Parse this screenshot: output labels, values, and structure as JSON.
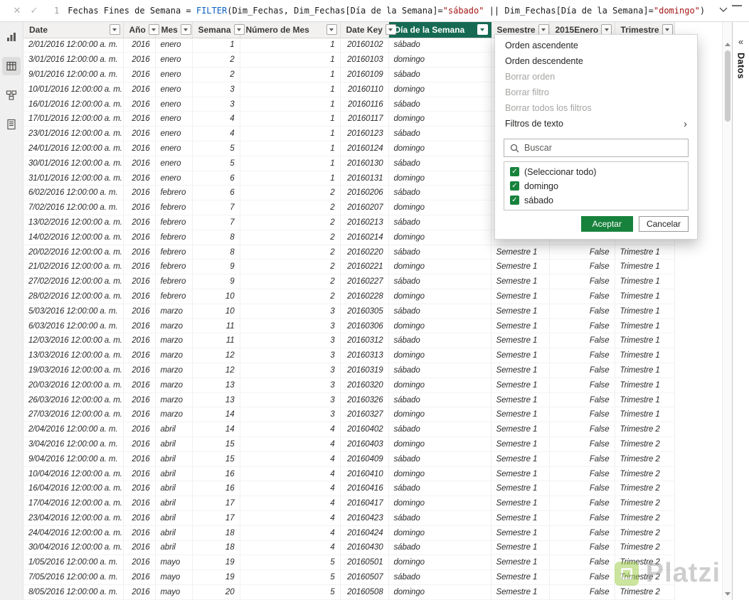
{
  "formula_bar": {
    "line_number": "1",
    "tokens": [
      {
        "text": "Fechas Fines de Semana = ",
        "type": "plain"
      },
      {
        "text": "FILTER",
        "type": "function"
      },
      {
        "text": "(Dim_Fechas, Dim_Fechas[Día de la Semana]=",
        "type": "plain"
      },
      {
        "text": "\"sábado\"",
        "type": "string"
      },
      {
        "text": " || Dim_Fechas[Día de la Semana]=",
        "type": "plain"
      },
      {
        "text": "\"domingo\"",
        "type": "string"
      },
      {
        "text": ")",
        "type": "plain"
      }
    ]
  },
  "table": {
    "columns": [
      {
        "label": "Date",
        "align": "right"
      },
      {
        "label": "Año",
        "align": "right"
      },
      {
        "label": "Mes",
        "align": "left"
      },
      {
        "label": "Semana",
        "align": "right"
      },
      {
        "label": "Número de Mes",
        "align": "right"
      },
      {
        "label": "Date Key",
        "align": "right"
      },
      {
        "label": "Día de la Semana",
        "align": "left",
        "selected": true
      },
      {
        "label": "Semestre",
        "align": "left"
      },
      {
        "label": "2015Enero",
        "align": "right"
      },
      {
        "label": "Trimestre",
        "align": "left"
      }
    ],
    "rows": [
      [
        "2/01/2016 12:00:00 a. m.",
        "2016",
        "enero",
        "1",
        "1",
        "20160102",
        "sábado",
        "",
        "",
        ""
      ],
      [
        "3/01/2016 12:00:00 a. m.",
        "2016",
        "enero",
        "2",
        "1",
        "20160103",
        "domingo",
        "",
        "",
        ""
      ],
      [
        "9/01/2016 12:00:00 a. m.",
        "2016",
        "enero",
        "2",
        "1",
        "20160109",
        "sábado",
        "",
        "",
        ""
      ],
      [
        "10/01/2016 12:00:00 a. m.",
        "2016",
        "enero",
        "3",
        "1",
        "20160110",
        "domingo",
        "",
        "",
        ""
      ],
      [
        "16/01/2016 12:00:00 a. m.",
        "2016",
        "enero",
        "3",
        "1",
        "20160116",
        "sábado",
        "",
        "",
        ""
      ],
      [
        "17/01/2016 12:00:00 a. m.",
        "2016",
        "enero",
        "4",
        "1",
        "20160117",
        "domingo",
        "",
        "",
        ""
      ],
      [
        "23/01/2016 12:00:00 a. m.",
        "2016",
        "enero",
        "4",
        "1",
        "20160123",
        "sábado",
        "",
        "",
        ""
      ],
      [
        "24/01/2016 12:00:00 a. m.",
        "2016",
        "enero",
        "5",
        "1",
        "20160124",
        "domingo",
        "",
        "",
        ""
      ],
      [
        "30/01/2016 12:00:00 a. m.",
        "2016",
        "enero",
        "5",
        "1",
        "20160130",
        "sábado",
        "",
        "",
        ""
      ],
      [
        "31/01/2016 12:00:00 a. m.",
        "2016",
        "enero",
        "6",
        "1",
        "20160131",
        "domingo",
        "",
        "",
        ""
      ],
      [
        "6/02/2016 12:00:00 a. m.",
        "2016",
        "febrero",
        "6",
        "2",
        "20160206",
        "sábado",
        "",
        "",
        ""
      ],
      [
        "7/02/2016 12:00:00 a. m.",
        "2016",
        "febrero",
        "7",
        "2",
        "20160207",
        "domingo",
        "",
        "",
        ""
      ],
      [
        "13/02/2016 12:00:00 a. m.",
        "2016",
        "febrero",
        "7",
        "2",
        "20160213",
        "sábado",
        "",
        "",
        ""
      ],
      [
        "14/02/2016 12:00:00 a. m.",
        "2016",
        "febrero",
        "8",
        "2",
        "20160214",
        "domingo",
        "Semestre 1",
        "False",
        "Trimestre 1"
      ],
      [
        "20/02/2016 12:00:00 a. m.",
        "2016",
        "febrero",
        "8",
        "2",
        "20160220",
        "sábado",
        "Semestre 1",
        "False",
        "Trimestre 1"
      ],
      [
        "21/02/2016 12:00:00 a. m.",
        "2016",
        "febrero",
        "9",
        "2",
        "20160221",
        "domingo",
        "Semestre 1",
        "False",
        "Trimestre 1"
      ],
      [
        "27/02/2016 12:00:00 a. m.",
        "2016",
        "febrero",
        "9",
        "2",
        "20160227",
        "sábado",
        "Semestre 1",
        "False",
        "Trimestre 1"
      ],
      [
        "28/02/2016 12:00:00 a. m.",
        "2016",
        "febrero",
        "10",
        "2",
        "20160228",
        "domingo",
        "Semestre 1",
        "False",
        "Trimestre 1"
      ],
      [
        "5/03/2016 12:00:00 a. m.",
        "2016",
        "marzo",
        "10",
        "3",
        "20160305",
        "sábado",
        "Semestre 1",
        "False",
        "Trimestre 1"
      ],
      [
        "6/03/2016 12:00:00 a. m.",
        "2016",
        "marzo",
        "11",
        "3",
        "20160306",
        "domingo",
        "Semestre 1",
        "False",
        "Trimestre 1"
      ],
      [
        "12/03/2016 12:00:00 a. m.",
        "2016",
        "marzo",
        "11",
        "3",
        "20160312",
        "sábado",
        "Semestre 1",
        "False",
        "Trimestre 1"
      ],
      [
        "13/03/2016 12:00:00 a. m.",
        "2016",
        "marzo",
        "12",
        "3",
        "20160313",
        "domingo",
        "Semestre 1",
        "False",
        "Trimestre 1"
      ],
      [
        "19/03/2016 12:00:00 a. m.",
        "2016",
        "marzo",
        "12",
        "3",
        "20160319",
        "sábado",
        "Semestre 1",
        "False",
        "Trimestre 1"
      ],
      [
        "20/03/2016 12:00:00 a. m.",
        "2016",
        "marzo",
        "13",
        "3",
        "20160320",
        "domingo",
        "Semestre 1",
        "False",
        "Trimestre 1"
      ],
      [
        "26/03/2016 12:00:00 a. m.",
        "2016",
        "marzo",
        "13",
        "3",
        "20160326",
        "sábado",
        "Semestre 1",
        "False",
        "Trimestre 1"
      ],
      [
        "27/03/2016 12:00:00 a. m.",
        "2016",
        "marzo",
        "14",
        "3",
        "20160327",
        "domingo",
        "Semestre 1",
        "False",
        "Trimestre 1"
      ],
      [
        "2/04/2016 12:00:00 a. m.",
        "2016",
        "abril",
        "14",
        "4",
        "20160402",
        "sábado",
        "Semestre 1",
        "False",
        "Trimestre 2"
      ],
      [
        "3/04/2016 12:00:00 a. m.",
        "2016",
        "abril",
        "15",
        "4",
        "20160403",
        "domingo",
        "Semestre 1",
        "False",
        "Trimestre 2"
      ],
      [
        "9/04/2016 12:00:00 a. m.",
        "2016",
        "abril",
        "15",
        "4",
        "20160409",
        "sábado",
        "Semestre 1",
        "False",
        "Trimestre 2"
      ],
      [
        "10/04/2016 12:00:00 a. m.",
        "2016",
        "abril",
        "16",
        "4",
        "20160410",
        "domingo",
        "Semestre 1",
        "False",
        "Trimestre 2"
      ],
      [
        "16/04/2016 12:00:00 a. m.",
        "2016",
        "abril",
        "16",
        "4",
        "20160416",
        "sábado",
        "Semestre 1",
        "False",
        "Trimestre 2"
      ],
      [
        "17/04/2016 12:00:00 a. m.",
        "2016",
        "abril",
        "17",
        "4",
        "20160417",
        "domingo",
        "Semestre 1",
        "False",
        "Trimestre 2"
      ],
      [
        "23/04/2016 12:00:00 a. m.",
        "2016",
        "abril",
        "17",
        "4",
        "20160423",
        "sábado",
        "Semestre 1",
        "False",
        "Trimestre 2"
      ],
      [
        "24/04/2016 12:00:00 a. m.",
        "2016",
        "abril",
        "18",
        "4",
        "20160424",
        "domingo",
        "Semestre 1",
        "False",
        "Trimestre 2"
      ],
      [
        "30/04/2016 12:00:00 a. m.",
        "2016",
        "abril",
        "18",
        "4",
        "20160430",
        "sábado",
        "Semestre 1",
        "False",
        "Trimestre 2"
      ],
      [
        "1/05/2016 12:00:00 a. m.",
        "2016",
        "mayo",
        "19",
        "5",
        "20160501",
        "domingo",
        "Semestre 1",
        "False",
        "Trimestre 2"
      ],
      [
        "7/05/2016 12:00:00 a. m.",
        "2016",
        "mayo",
        "19",
        "5",
        "20160507",
        "sábado",
        "Semestre 1",
        "False",
        "Trimestre 2"
      ],
      [
        "8/05/2016 12:00:00 a. m.",
        "2016",
        "mayo",
        "20",
        "5",
        "20160508",
        "domingo",
        "Semestre 1",
        "False",
        "Trimestre 2"
      ]
    ]
  },
  "filter_menu": {
    "items": [
      {
        "label": "Orden ascendente",
        "disabled": false
      },
      {
        "label": "Orden descendente",
        "disabled": false
      },
      {
        "label": "Borrar orden",
        "disabled": true
      },
      {
        "label": "Borrar filtro",
        "disabled": true
      },
      {
        "label": "Borrar todos los filtros",
        "disabled": true
      },
      {
        "label": "Filtros de texto",
        "disabled": false,
        "submenu": true
      }
    ],
    "search_placeholder": "Buscar",
    "options": [
      {
        "label": "(Seleccionar todo)",
        "checked": true
      },
      {
        "label": "domingo",
        "checked": true
      },
      {
        "label": "sábado",
        "checked": true
      }
    ],
    "accept_label": "Aceptar",
    "cancel_label": "Cancelar"
  },
  "right_panel": {
    "title": "Datos",
    "collapse_icon": "«"
  },
  "watermark": {
    "text": "Platzi"
  },
  "colors": {
    "header_selected": "#166a53",
    "accept_button": "#17823c",
    "checkbox_green": "#17823c",
    "dax_function": "#0b61c1",
    "dax_string": "#a31515",
    "platzi_green": "#98ca3f"
  }
}
